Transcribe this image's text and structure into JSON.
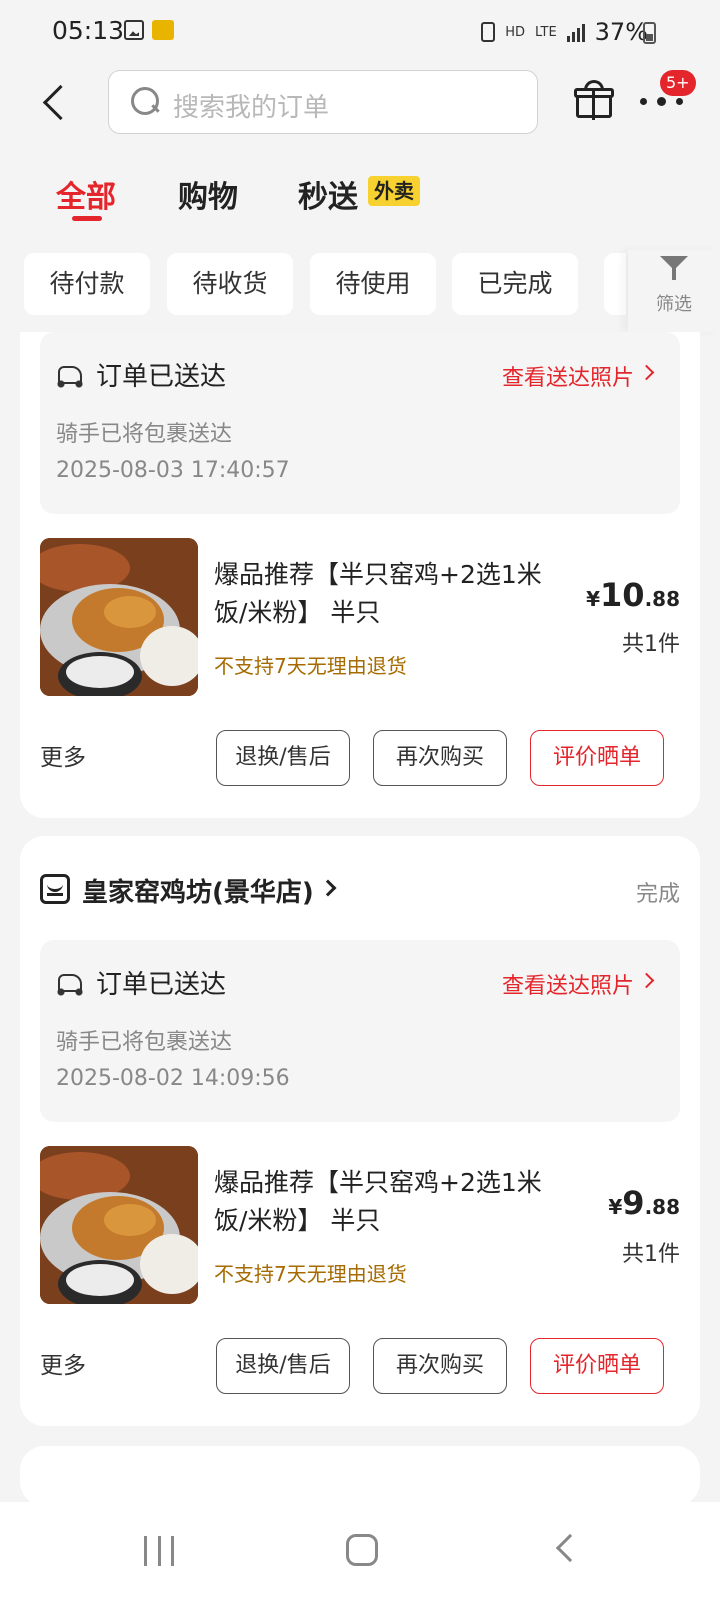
{
  "status_bar": {
    "time": "05:13",
    "network": "HD",
    "lte": "LTE",
    "battery": "37%"
  },
  "header": {
    "search_placeholder": "搜索我的订单",
    "notification_badge": "5+"
  },
  "tabs": [
    {
      "label": "全部",
      "active": true
    },
    {
      "label": "购物",
      "active": false
    },
    {
      "label": "秒送",
      "active": false,
      "badge": "外卖"
    }
  ],
  "filters": {
    "chips": [
      "待付款",
      "待收货",
      "待使用",
      "已完成"
    ],
    "filter_label": "筛选"
  },
  "colors": {
    "accent": "#e4262c",
    "note": "#a66a00",
    "tag_yellow": "#f7d12f"
  },
  "orders": [
    {
      "store_name": "",
      "status": "",
      "delivery_title": "订单已送达",
      "delivery_link": "查看送达照片",
      "delivery_sub": "骑手已将包裹送达",
      "delivery_time": "2025-08-03 17:40:57",
      "product_name": "爆品推荐【半只窑鸡+2选1米饭/米粉】 半只",
      "product_note": "不支持7天无理由退货",
      "price_currency": "¥",
      "price_int": "10",
      "price_dec": ".88",
      "qty": "共1件",
      "more": "更多",
      "buttons": [
        "退换/售后",
        "再次购买",
        "评价晒单"
      ]
    },
    {
      "store_name": "皇家窑鸡坊(景华店)",
      "status": "完成",
      "delivery_title": "订单已送达",
      "delivery_link": "查看送达照片",
      "delivery_sub": "骑手已将包裹送达",
      "delivery_time": "2025-08-02 14:09:56",
      "product_name": "爆品推荐【半只窑鸡+2选1米饭/米粉】 半只",
      "product_note": "不支持7天无理由退货",
      "price_currency": "¥",
      "price_int": "9",
      "price_dec": ".88",
      "qty": "共1件",
      "more": "更多",
      "buttons": [
        "退换/售后",
        "再次购买",
        "评价晒单"
      ]
    }
  ]
}
